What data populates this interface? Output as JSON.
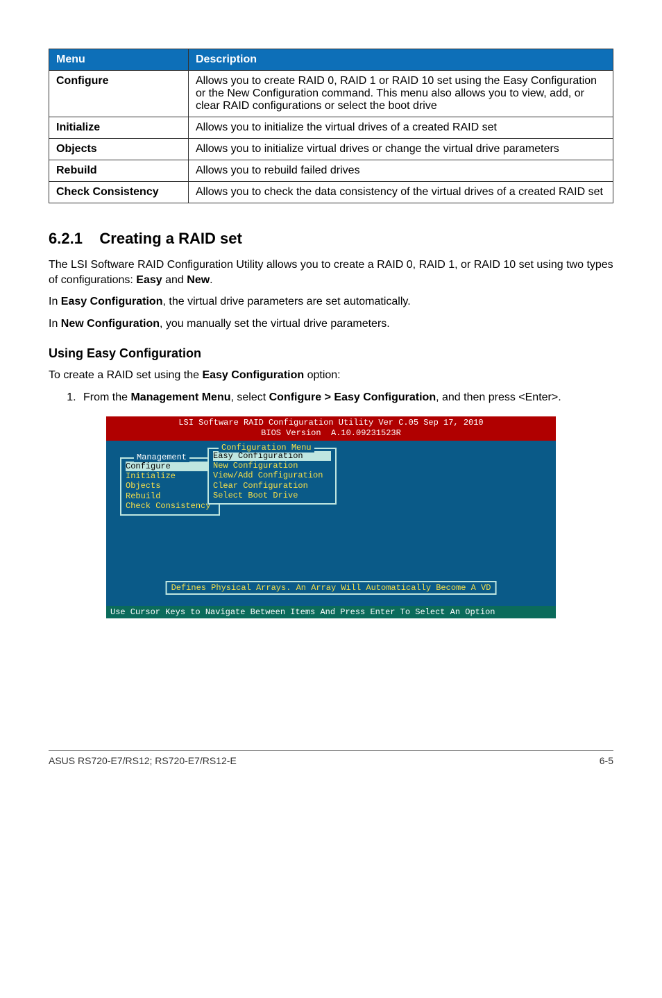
{
  "table": {
    "headers": [
      "Menu",
      "Description"
    ],
    "rows": [
      {
        "menu": "Configure",
        "desc": "Allows you to create RAID 0, RAID 1 or RAID 10 set using the Easy Configuration or the New Configuration command. This menu also allows you to view, add, or clear RAID configurations or select the boot drive"
      },
      {
        "menu": "Initialize",
        "desc": "Allows you to initialize the virtual drives of a created RAID set"
      },
      {
        "menu": "Objects",
        "desc": "Allows you to initialize virtual drives or change the virtual drive parameters"
      },
      {
        "menu": "Rebuild",
        "desc": "Allows you to rebuild failed drives"
      },
      {
        "menu": "Check Consistency",
        "desc": "Allows you to check the data consistency of the virtual drives of a created RAID set"
      }
    ]
  },
  "section_number": "6.2.1",
  "section_title": "Creating a RAID set",
  "para1_pre": "The LSI Software RAID Configuration Utility allows you to create a RAID 0, RAID 1, or RAID 10 set using two types of configurations: ",
  "para1_b1": "Easy",
  "para1_mid": " and ",
  "para1_b2": "New",
  "para1_post": ".",
  "para2_pre": "In ",
  "para2_b": "Easy Configuration",
  "para2_post": ", the virtual drive parameters are set automatically.",
  "para3_pre": "In ",
  "para3_b": "New Configuration",
  "para3_post": ", you manually set the virtual drive parameters.",
  "subhead": "Using Easy Configuration",
  "subpara_pre": "To create a RAID set using the ",
  "subpara_b": "Easy Configuration",
  "subpara_post": " option:",
  "step1_pre": "From the ",
  "step1_b1": "Management Menu",
  "step1_mid": ", select ",
  "step1_b2": "Configure > Easy Configuration",
  "step1_post": ", and then press <Enter>.",
  "bios": {
    "title_line1": "LSI Software RAID Configuration Utility Ver C.05 Sep 17, 2010",
    "title_line2": "BIOS Version  A.10.09231523R",
    "mgmt_legend": "Management",
    "mgmt_items": [
      "Configure",
      "Initialize",
      "Objects",
      "Rebuild",
      "Check Consistency"
    ],
    "cfg_legend": "Configuration Menu",
    "cfg_items": [
      "Easy Configuration",
      "New Configuration",
      "View/Add Configuration",
      "Clear Configuration",
      "Select Boot Drive"
    ],
    "hint": "Defines Physical Arrays. An Array Will Automatically Become A VD",
    "footer": "Use Cursor Keys to Navigate Between Items And Press Enter To Select An Option"
  },
  "footer_left": "ASUS RS720-E7/RS12; RS720-E7/RS12-E",
  "footer_right": "6-5"
}
